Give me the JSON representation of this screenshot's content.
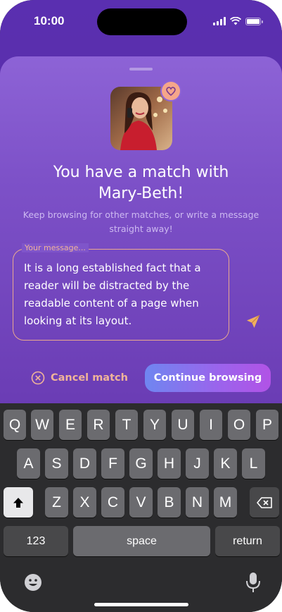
{
  "status": {
    "time": "10:00"
  },
  "match": {
    "title_line1": "You have a match with",
    "title_line2": "Mary-Beth!",
    "subtitle": "Keep browsing for other matches, or write a message straight away!",
    "message_label": "Your message...",
    "message_value": "It is a long established fact that a reader will be distracted by the readable content of a page when looking at its layout.",
    "cancel_label": "Cancel match",
    "continue_label": "Continue browsing"
  },
  "colors": {
    "accent": "#f0b499",
    "sheet": "#7d51c8",
    "button_start": "#6f86f0",
    "button_end": "#b153e6"
  },
  "keyboard": {
    "row1": [
      "Q",
      "W",
      "E",
      "R",
      "T",
      "Y",
      "U",
      "I",
      "O",
      "P"
    ],
    "row2": [
      "A",
      "S",
      "D",
      "F",
      "G",
      "H",
      "J",
      "K",
      "L"
    ],
    "row3": [
      "Z",
      "X",
      "C",
      "V",
      "B",
      "N",
      "M"
    ],
    "numbers_key": "123",
    "space_key": "space",
    "return_key": "return",
    "icons": [
      "shift-icon",
      "backspace-icon",
      "emoji-icon",
      "microphone-icon"
    ]
  }
}
